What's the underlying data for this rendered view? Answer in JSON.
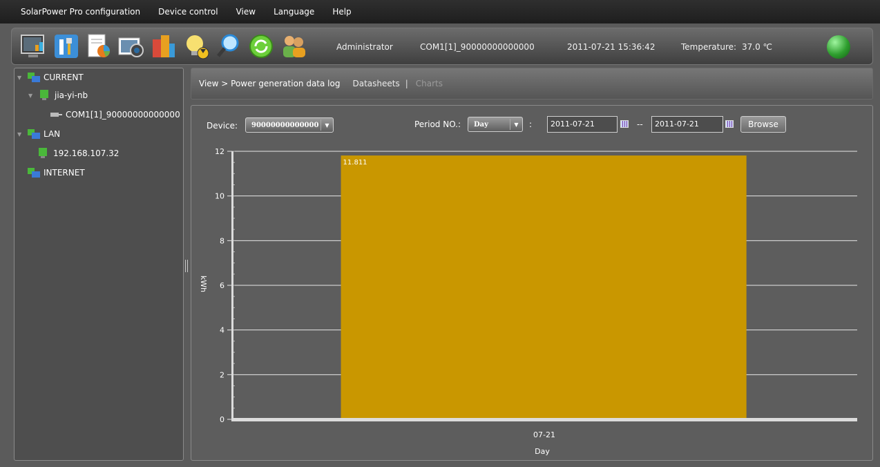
{
  "menu": [
    "SolarPower Pro configuration",
    "Device control",
    "View",
    "Language",
    "Help"
  ],
  "toolbar": {
    "icons": [
      "monitor-icon",
      "tools-icon",
      "report-icon",
      "camera-icon",
      "building-icon",
      "bulb-icon",
      "magnifier-icon",
      "refresh-icon",
      "users-icon"
    ],
    "user": "Administrator",
    "port": "COM1[1]_90000000000000",
    "datetime": "2011-07-21 15:36:42",
    "temperature_label": "Temperature:",
    "temperature_value": "37.0 ℃"
  },
  "sidebar": {
    "current": "CURRENT",
    "host": "jia-yi-nb",
    "port": "COM1[1]_90000000000000",
    "lan": "LAN",
    "ip": "192.168.107.32",
    "internet": "INTERNET"
  },
  "breadcrumb": {
    "path": "View > Power generation data log",
    "datasheets": "Datasheets",
    "separator": "|",
    "charts": "Charts"
  },
  "filters": {
    "device_label": "Device:",
    "device_value": "90000000000000",
    "period_label": "Period NO.:",
    "period_value": "Day",
    "colon": ":",
    "date_from": "2011-07-21",
    "date_sep": "--",
    "date_to": "2011-07-21",
    "browse": "Browse"
  },
  "chart_data": {
    "type": "bar",
    "categories": [
      "07-21"
    ],
    "values": [
      11.811
    ],
    "data_labels": [
      "11.811"
    ],
    "xlabel": "Day",
    "ylabel": "kWh",
    "ylim": [
      0,
      12
    ],
    "yticks": [
      0,
      2,
      4,
      6,
      8,
      10,
      12
    ],
    "grid": true,
    "bar_color": "#c99700"
  }
}
